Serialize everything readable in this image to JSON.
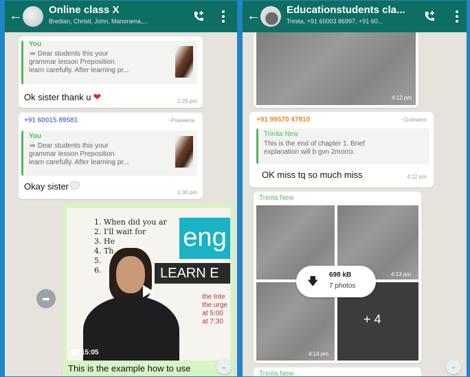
{
  "left_chat": {
    "header": {
      "title": "Online class X",
      "members": "Bredian, Christi, John, Manorama,..."
    },
    "msg1": {
      "quote_name": "You",
      "quote_line1": "≔ Dear students this your",
      "quote_line2": "grammar lesson Preposition",
      "quote_line3": "learn carefully. After learning pr...",
      "text": "Ok sister thank u",
      "time": "1:29 pm"
    },
    "msg2": {
      "sender": "+91 60015 89581",
      "alt_name": "~Praveena",
      "quote_name": "You",
      "quote_line1": "≔ Dear students this your",
      "quote_line2": "grammar lesson Preposition",
      "quote_line3": "learn carefully. After learning pr...",
      "text": "Okay sister",
      "time": "1:30 pm"
    },
    "video": {
      "board_lines": [
        "1. When did you ar",
        "2. I'll wait for",
        "3. He",
        "4. Th",
        "5.",
        "6."
      ],
      "brand": "eng",
      "banner": "LEARN E",
      "board_right": [
        "the Inte",
        "the urge",
        "at 5:00",
        "at 7:30"
      ],
      "duration": "15:05",
      "caption": "This is the example  how to use"
    }
  },
  "right_chat": {
    "header": {
      "title": "Educationstudents cla...",
      "members": "Trinita, +91 60003 86997, +91 60..."
    },
    "img_top": {
      "time": "4:12 pm"
    },
    "msg1": {
      "sender": "+91 99570 47810",
      "alt_name": "~Grahams",
      "quote_name": "Trinita New",
      "quote_line1": "This is the end of chapter 1.  Brief",
      "quote_line2": "explanation will b gvn 2morro.",
      "text": "OK miss tq so much miss",
      "time": "4:12 pm"
    },
    "album": {
      "sender": "Trinita New",
      "download_size": "698 kB",
      "download_count": "7 photos",
      "time_top": "4:13 pm",
      "more": "+ 4",
      "time_bottom": "4:14 pm"
    },
    "next_sender": "Trinita New"
  }
}
